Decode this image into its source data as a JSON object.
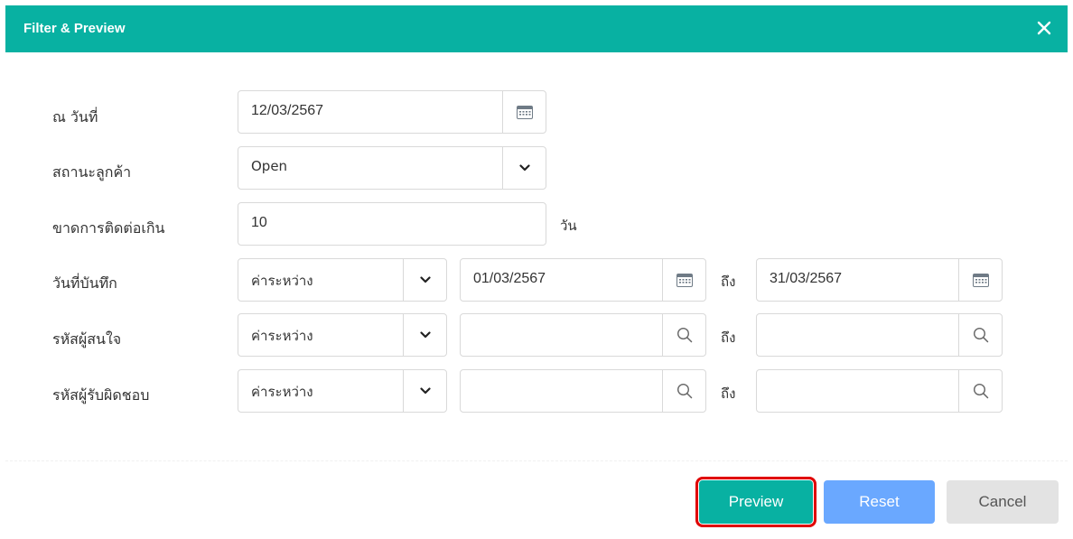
{
  "dialog": {
    "title": "Filter & Preview"
  },
  "form": {
    "as_of_date": {
      "label": "ณ วันที่",
      "value": "12/03/2567"
    },
    "customer_status": {
      "label": "สถานะลูกค้า",
      "value": "Open"
    },
    "no_contact": {
      "label": "ขาดการติดต่อเกิน",
      "value": "10",
      "suffix": "วัน"
    },
    "record_date": {
      "label": "วันที่บันทึก",
      "operator": "ค่าระหว่าง",
      "from": "01/03/2567",
      "to_label": "ถึง",
      "to": "31/03/2567"
    },
    "prospect_code": {
      "label": "รหัสผู้สนใจ",
      "operator": "ค่าระหว่าง",
      "from": "",
      "to_label": "ถึง",
      "to": ""
    },
    "owner_code": {
      "label": "รหัสผู้รับผิดชอบ",
      "operator": "ค่าระหว่าง",
      "from": "",
      "to_label": "ถึง",
      "to": ""
    }
  },
  "buttons": {
    "preview": "Preview",
    "reset": "Reset",
    "cancel": "Cancel"
  },
  "colors": {
    "header": "#08b1a2",
    "preview": "#08b1a2",
    "reset": "#6aa8ff",
    "cancel": "#e3e3e3",
    "highlight": "#e00000"
  },
  "icons": [
    "close-icon",
    "calendar-icon",
    "chevron-down-icon",
    "search-icon"
  ]
}
